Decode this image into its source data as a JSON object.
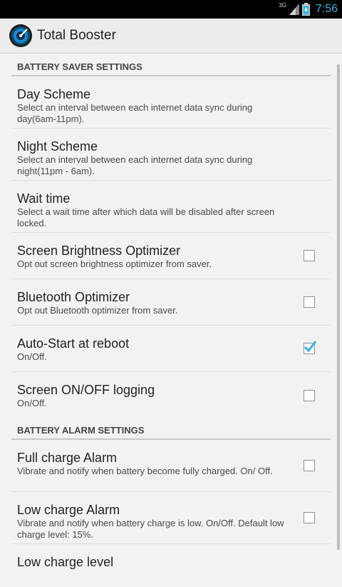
{
  "status": {
    "network": "3G",
    "time": "7:56"
  },
  "app": {
    "title": "Total Booster",
    "icon": "speedometer-icon"
  },
  "sections": [
    {
      "header": "BATTERY SAVER SETTINGS"
    },
    {
      "header": "BATTERY ALARM SETTINGS"
    }
  ],
  "items": [
    {
      "title": "Day Scheme",
      "summary": "Select an interval between each internet data sync during day(6am-11pm)."
    },
    {
      "title": "Night Scheme",
      "summary": "Select an interval between each internet data sync during night(11pm - 6am)."
    },
    {
      "title": "Wait time",
      "summary": "Select a wait time after which data will be disabled after screen locked."
    },
    {
      "title": "Screen Brightness Optimizer",
      "summary": "Opt out screen brightness optimizer from saver.",
      "checked": false
    },
    {
      "title": "Bluetooth Optimizer",
      "summary": "Opt out Bluetooth optimizer from saver.",
      "checked": false
    },
    {
      "title": "Auto-Start at reboot",
      "summary": "On/Off.",
      "checked": true
    },
    {
      "title": "Screen ON/OFF logging",
      "summary": "On/Off.",
      "checked": false
    },
    {
      "title": "Full charge Alarm",
      "summary": "Vibrate and notify when battery become fully charged. On/ Off.",
      "checked": false
    },
    {
      "title": "Low charge Alarm",
      "summary": "Vibrate and notify when battery charge is low. On/Off. Default low charge level: 15%.",
      "checked": false
    },
    {
      "title": "Low charge level"
    }
  ],
  "colors": {
    "accent": "#33b5e5"
  }
}
